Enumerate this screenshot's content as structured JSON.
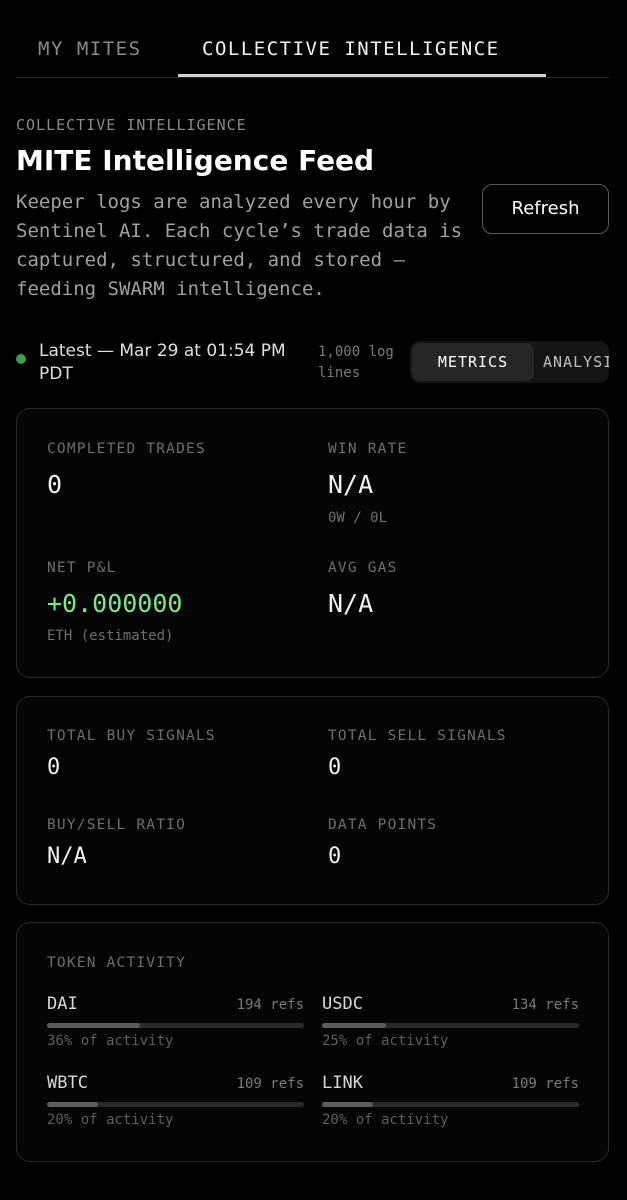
{
  "tabs": {
    "my_mites": "MY MITES",
    "collective": "COLLECTIVE INTELLIGENCE"
  },
  "header": {
    "eyebrow": "COLLECTIVE INTELLIGENCE",
    "title": "MITE Intelligence Feed",
    "description": "Keeper logs are analyzed every hour by Sentinel AI. Each cycle’s trade data is captured, structured, and stored — feeding SWARM intelligence.",
    "refresh_label": "Refresh"
  },
  "status": {
    "latest": "Latest — Mar 29 at 01:54 PM PDT",
    "log_lines": "1,000 log lines",
    "dot_color": "#3e9e4a"
  },
  "view_toggle": {
    "metrics": "METRICS",
    "analysis": "ANALYSIS",
    "selected": "METRICS"
  },
  "trade_metrics": {
    "completed_trades": {
      "label": "COMPLETED TRADES",
      "value": "0"
    },
    "win_rate": {
      "label": "WIN RATE",
      "value": "N/A",
      "sub": "0W / 0L"
    },
    "net_pnl": {
      "label": "NET P&L",
      "value": "+0.000000",
      "sub": "ETH (estimated)",
      "color": "#7ee787"
    },
    "avg_gas": {
      "label": "AVG GAS",
      "value": "N/A"
    }
  },
  "signal_metrics": {
    "total_buy": {
      "label": "TOTAL BUY SIGNALS",
      "value": "0"
    },
    "total_sell": {
      "label": "TOTAL SELL SIGNALS",
      "value": "0"
    },
    "ratio": {
      "label": "BUY/SELL RATIO",
      "value": "N/A"
    },
    "data_points": {
      "label": "DATA POINTS",
      "value": "0"
    }
  },
  "token_activity": {
    "label": "TOKEN ACTIVITY",
    "tokens": [
      {
        "name": "DAI",
        "refs": "194 refs",
        "pct_text": "36% of activity",
        "fraction": 0.36
      },
      {
        "name": "USDC",
        "refs": "134 refs",
        "pct_text": "25% of activity",
        "fraction": 0.25
      },
      {
        "name": "WBTC",
        "refs": "109 refs",
        "pct_text": "20% of activity",
        "fraction": 0.2
      },
      {
        "name": "LINK",
        "refs": "109 refs",
        "pct_text": "20% of activity",
        "fraction": 0.2
      }
    ]
  }
}
